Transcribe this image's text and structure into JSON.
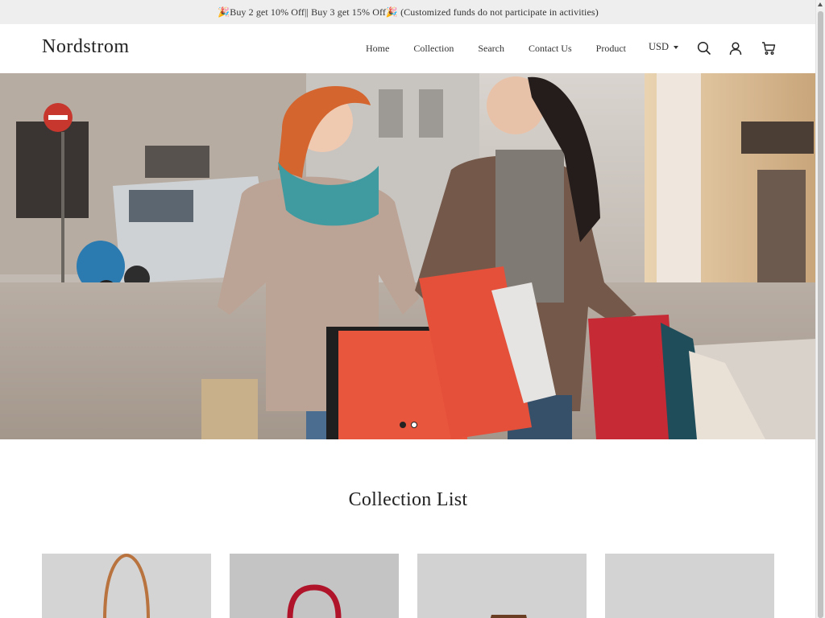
{
  "announcement": {
    "text": "🎉Buy 2 get 10% Off|| Buy 3 get 15% Off🎉 (Customized funds do not participate in activities)"
  },
  "header": {
    "logo": "Nordstrom",
    "nav": [
      {
        "label": "Home"
      },
      {
        "label": "Collection"
      },
      {
        "label": "Search"
      },
      {
        "label": "Contact Us"
      },
      {
        "label": "Product"
      }
    ],
    "currency": "USD",
    "icons": [
      "search-icon",
      "account-icon",
      "cart-icon"
    ]
  },
  "hero": {
    "slide_count": 2,
    "active_slide": 1
  },
  "collection": {
    "title": "Collection List",
    "cards": [
      {
        "product": "tan-handbag-icon"
      },
      {
        "product": "red-handbag-icon"
      },
      {
        "product": "brown-handbag-icon"
      },
      {
        "product": "empty-image"
      }
    ]
  },
  "colors": {
    "announcement_bg": "#eeeeee",
    "text": "#222222",
    "card_bg": "#d2d2d2"
  }
}
